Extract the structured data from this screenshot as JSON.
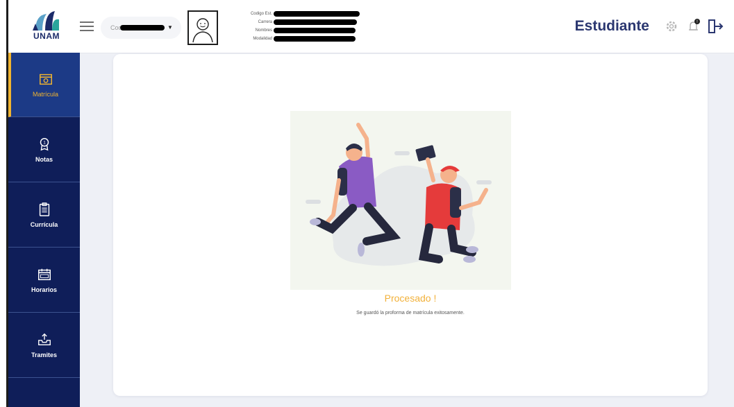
{
  "header": {
    "logo_text": "UNAM",
    "cod_label": "Cod",
    "info_labels": [
      "Codigo Est.",
      "Carrera",
      "Nombres",
      "Modalidad"
    ],
    "role_title": "Estudiante"
  },
  "sidebar": {
    "items": [
      {
        "label": "Matrícula",
        "icon": "calendar-clock-icon",
        "active": true
      },
      {
        "label": "Notas",
        "icon": "award-icon",
        "active": false
      },
      {
        "label": "Currícula",
        "icon": "clipboard-icon",
        "active": false
      },
      {
        "label": "Horarios",
        "icon": "calendar-icon",
        "active": false
      },
      {
        "label": "Tramites",
        "icon": "inbox-upload-icon",
        "active": false
      }
    ]
  },
  "main": {
    "title": "Procesado !",
    "message": "Se guardó la proforma de matrícula exitosamente."
  },
  "colors": {
    "sidebar": "#0f1e59",
    "accent": "#f0b430",
    "brand_text": "#2b3770"
  }
}
